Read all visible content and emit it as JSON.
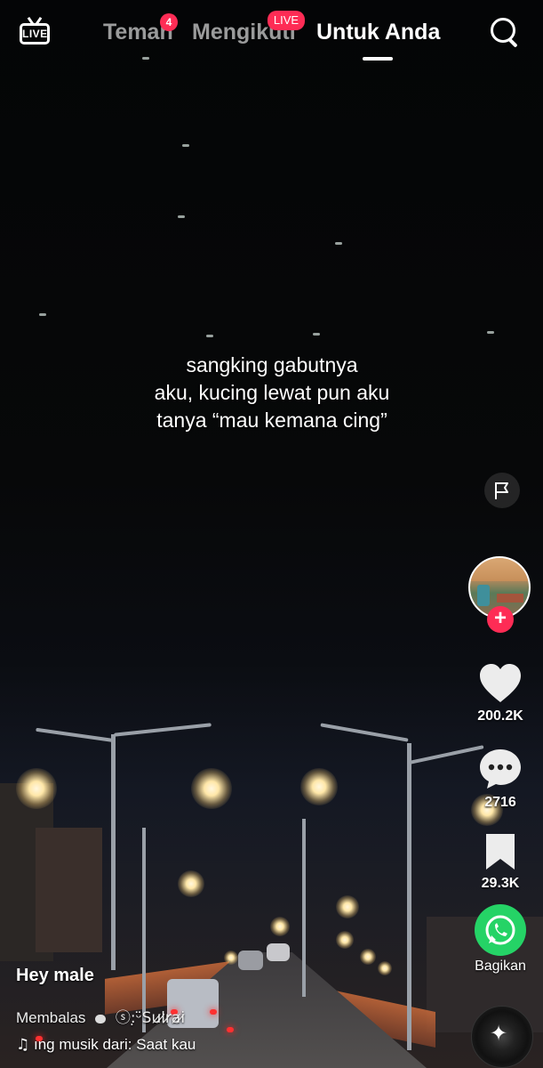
{
  "topbar": {
    "live_label": "LIVE",
    "tabs": [
      {
        "label": "Teman",
        "badge": "4"
      },
      {
        "label": "Mengikuti",
        "badge": "LIVE"
      },
      {
        "label": "Untuk Anda"
      }
    ]
  },
  "video": {
    "caption_lines": [
      "sangking gabutnya",
      "aku, kucing lewat pun aku",
      "tanya “mau kemana cing”"
    ]
  },
  "actions": {
    "follow_symbol": "+",
    "likes": "200.2K",
    "comments": "2716",
    "saves": "29.3K",
    "share_label": "Bagikan"
  },
  "post": {
    "username": "Hey male",
    "reply_prefix": "Membalas",
    "reply_target": "ⓢ:̣ᵕ̈Su̷l̷r̷a̷i̷",
    "music_note": "♫",
    "music_text": "ıng musik dari: Saat kau"
  },
  "colors": {
    "accent": "#fe2c55",
    "whatsapp": "#25d366",
    "background": "#000000"
  },
  "icons": [
    "live-tv-icon",
    "search-icon",
    "flag-icon",
    "plus-icon",
    "heart-icon",
    "comment-icon",
    "bookmark-icon",
    "whatsapp-icon",
    "music-disc-icon",
    "music-note-icon",
    "chat-bubble-icon"
  ]
}
